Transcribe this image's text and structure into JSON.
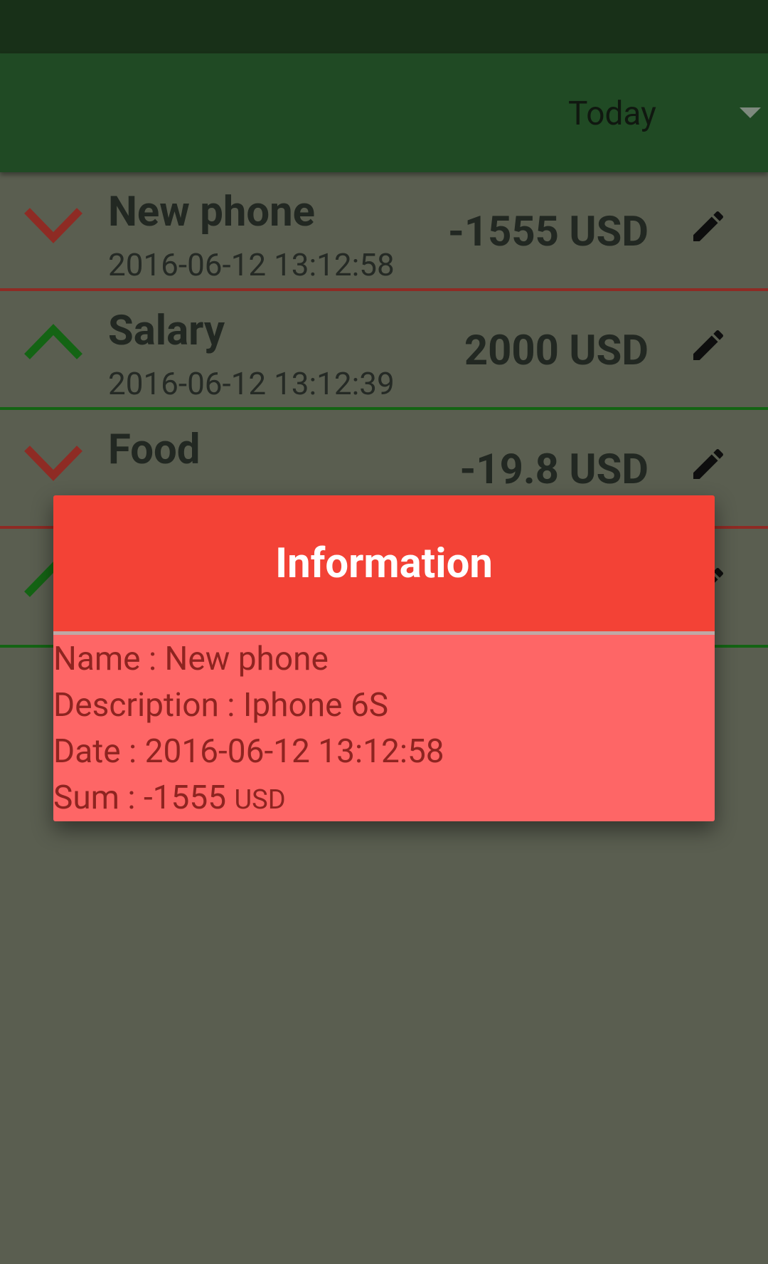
{
  "toolbar": {
    "period": "Today"
  },
  "transactions": [
    {
      "name": "New phone",
      "date": "2016-06-12 13:12:58",
      "amount": "-1555 USD",
      "type": "expense"
    },
    {
      "name": "Salary",
      "date": "2016-06-12 13:12:39",
      "amount": "2000 USD",
      "type": "income"
    },
    {
      "name": "Food",
      "date": "",
      "amount": "-19.8 USD",
      "type": "expense"
    },
    {
      "name": "",
      "date": "",
      "amount": "",
      "type": "income"
    }
  ],
  "dialog": {
    "title": "Information",
    "name_line": "Name : New phone",
    "description_line": "Description : Iphone 6S",
    "date_line": "Date : 2016-06-12 13:12:58",
    "sum_value": "Sum : -1555 ",
    "sum_currency": "USD"
  },
  "colors": {
    "expense": "#8E2B24",
    "income": "#146414",
    "dialog_header": "#F34236",
    "dialog_body": "#FE6666"
  },
  "icons": [
    "chevron-down-icon",
    "chevron-up-icon",
    "pencil-icon",
    "dropdown-arrow-icon"
  ]
}
